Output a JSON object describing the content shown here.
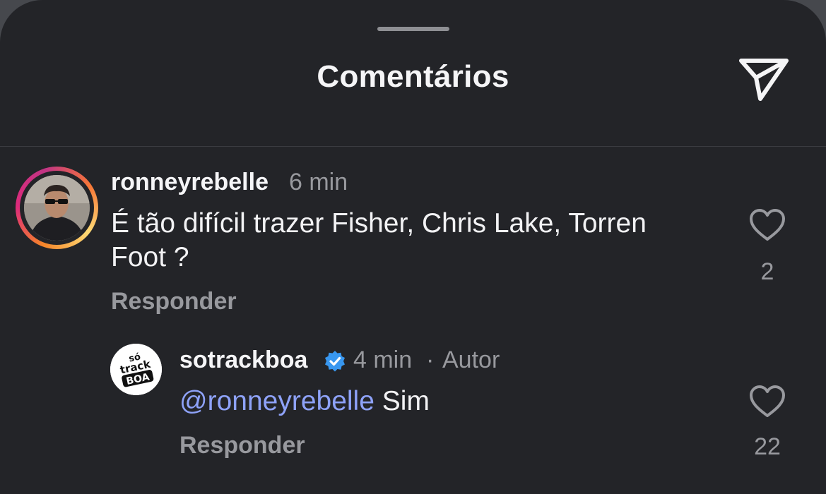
{
  "header": {
    "title": "Comentários"
  },
  "comments": [
    {
      "username": "ronneyrebelle",
      "time": "6 min",
      "text_line1": "É tão difícil trazer Fisher, Chris Lake, Torren",
      "text_line2": "Foot ?",
      "reply_label": "Responder",
      "likes": "2"
    },
    {
      "username": "sotrackboa",
      "time": "4 min",
      "separator": "·",
      "author_badge": "Autor",
      "mention": "@ronneyrebelle",
      "text": "Sim",
      "reply_label": "Responder",
      "likes": "22",
      "avatar_logo": [
        "só",
        "track",
        "BOA"
      ]
    }
  ],
  "colors": {
    "background": "#232428",
    "mention": "#8ea2f8",
    "verified": "#3897f0"
  }
}
